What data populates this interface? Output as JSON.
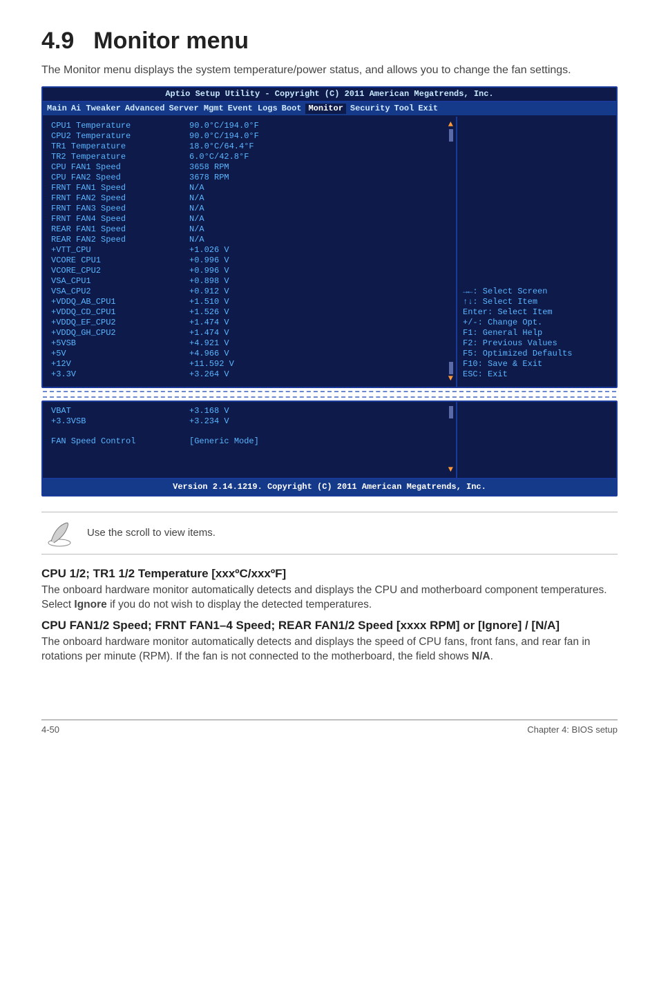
{
  "heading": {
    "num": "4.9",
    "title": "Monitor menu"
  },
  "intro": "The Monitor menu displays the system temperature/power status, and allows you to change the fan settings.",
  "bios": {
    "title": "Aptio Setup Utility - Copyright (C) 2011 American Megatrends, Inc.",
    "footer": "Version 2.14.1219. Copyright (C) 2011 American Megatrends, Inc.",
    "tabs": [
      "Main",
      "Ai Tweaker",
      "Advanced",
      "Server Mgmt",
      "Event Logs",
      "Boot",
      "Monitor",
      "Security",
      "Tool",
      "Exit"
    ],
    "active_tab": "Monitor",
    "help": [
      "→←: Select Screen",
      "↑↓:  Select Item",
      "Enter: Select Item",
      "+/-: Change Opt.",
      "F1: General Help",
      "F2: Previous Values",
      "F5: Optimized Defaults",
      "F10: Save & Exit",
      "ESC: Exit"
    ],
    "rows1": [
      {
        "label": "CPU1 Temperature",
        "value": "90.0°C/194.0°F"
      },
      {
        "label": "CPU2 Temperature",
        "value": "90.0°C/194.0°F"
      },
      {
        "label": "TR1 Temperature",
        "value": "18.0°C/64.4°F"
      },
      {
        "label": "TR2 Temperature",
        "value": "6.0°C/42.8°F"
      },
      {
        "label": "CPU FAN1 Speed",
        "value": "3658 RPM"
      },
      {
        "label": "CPU FAN2 Speed",
        "value": "3678 RPM"
      },
      {
        "label": "FRNT FAN1 Speed",
        "value": "N/A"
      },
      {
        "label": "FRNT FAN2 Speed",
        "value": "N/A"
      },
      {
        "label": "FRNT FAN3 Speed",
        "value": "N/A"
      },
      {
        "label": "FRNT FAN4 Speed",
        "value": "N/A"
      },
      {
        "label": "REAR FAN1 Speed",
        "value": "N/A"
      },
      {
        "label": "REAR FAN2 Speed",
        "value": "N/A"
      },
      {
        "label": "+VTT_CPU",
        "value": "+1.026 V"
      },
      {
        "label": "VCORE CPU1",
        "value": "+0.996 V"
      },
      {
        "label": "VCORE_CPU2",
        "value": "+0.996 V"
      },
      {
        "label": "VSA_CPU1",
        "value": "+0.898 V"
      },
      {
        "label": "VSA_CPU2",
        "value": "+0.912 V"
      },
      {
        "label": "+VDDQ_AB_CPU1",
        "value": "+1.510 V"
      },
      {
        "label": "+VDDQ_CD_CPU1",
        "value": "+1.526 V"
      },
      {
        "label": "+VDDQ_EF_CPU2",
        "value": "+1.474 V"
      },
      {
        "label": "+VDDQ_GH_CPU2",
        "value": "+1.474 V"
      },
      {
        "label": "+5VSB",
        "value": "+4.921 V"
      },
      {
        "label": "+5V",
        "value": "+4.966 V"
      },
      {
        "label": "+12V",
        "value": "+11.592 V"
      },
      {
        "label": "+3.3V",
        "value": "+3.264 V"
      }
    ],
    "rows2": [
      {
        "label": "VBAT",
        "value": "+3.168 V"
      },
      {
        "label": "+3.3VSB",
        "value": "+3.234 V"
      }
    ],
    "rows2b": [
      {
        "label": "FAN Speed Control",
        "value": "Generic Mode",
        "bracket": true
      }
    ]
  },
  "note": "Use the scroll to view items.",
  "sub1_title": "CPU 1/2; TR1 1/2 Temperature [xxxºC/xxxºF]",
  "sub1_text_pre": "The onboard hardware monitor automatically detects and displays the CPU and motherboard component temperatures. Select ",
  "sub1_bold": "Ignore",
  "sub1_text_post": " if you do not wish to display the detected temperatures.",
  "sub2_title": "CPU FAN1/2 Speed; FRNT FAN1–4 Speed; REAR FAN1/2 Speed [xxxx RPM] or [Ignore] / [N/A]",
  "sub2_text_pre": "The onboard hardware monitor automatically detects and displays the speed of CPU fans, front fans, and rear fan in rotations per minute (RPM). If the fan is not connected to the motherboard, the field shows ",
  "sub2_bold": "N/A",
  "sub2_text_post": ".",
  "footer_page": "4-50",
  "footer_chapter": "Chapter 4: BIOS setup"
}
